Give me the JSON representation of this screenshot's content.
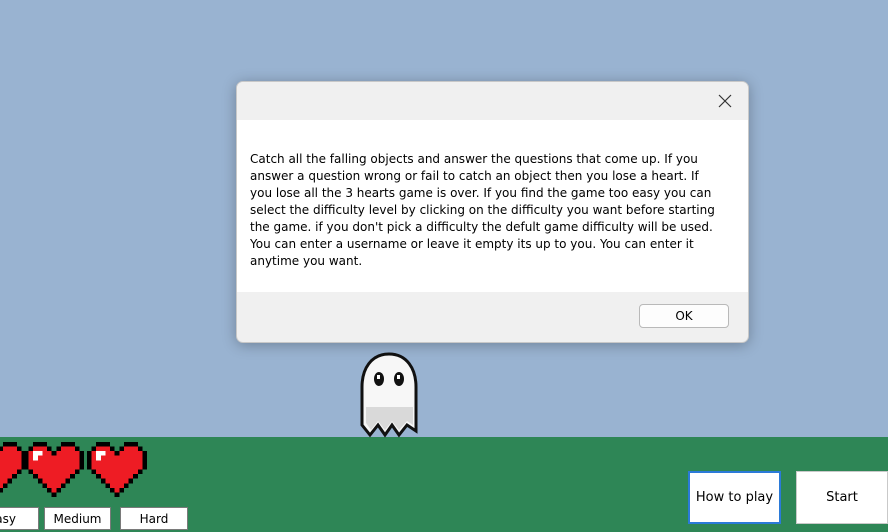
{
  "game": {
    "hearts_remaining": 3,
    "difficulty_buttons": [
      "Easy",
      "Medium",
      "Hard"
    ],
    "how_to_play_label": "How to play",
    "start_label": "Start",
    "colors": {
      "sky": "#99b3d1",
      "ground": "#2e8656",
      "heart": "#ee1c24"
    }
  },
  "dialog": {
    "message": "Catch all the falling objects and answer the questions that come up. If you answer a question wrong or fail to catch an object then you lose a heart. If you lose all the 3 hearts game is over. If you find the game too easy you can select the difficulty level by clicking on the difficulty you want before starting the game. if you don't pick a difficulty the defult game difficulty will be used. You can enter a username or leave it empty its up to you. You can enter it anytime you want.",
    "ok_label": "OK",
    "close_icon": "close-icon"
  }
}
